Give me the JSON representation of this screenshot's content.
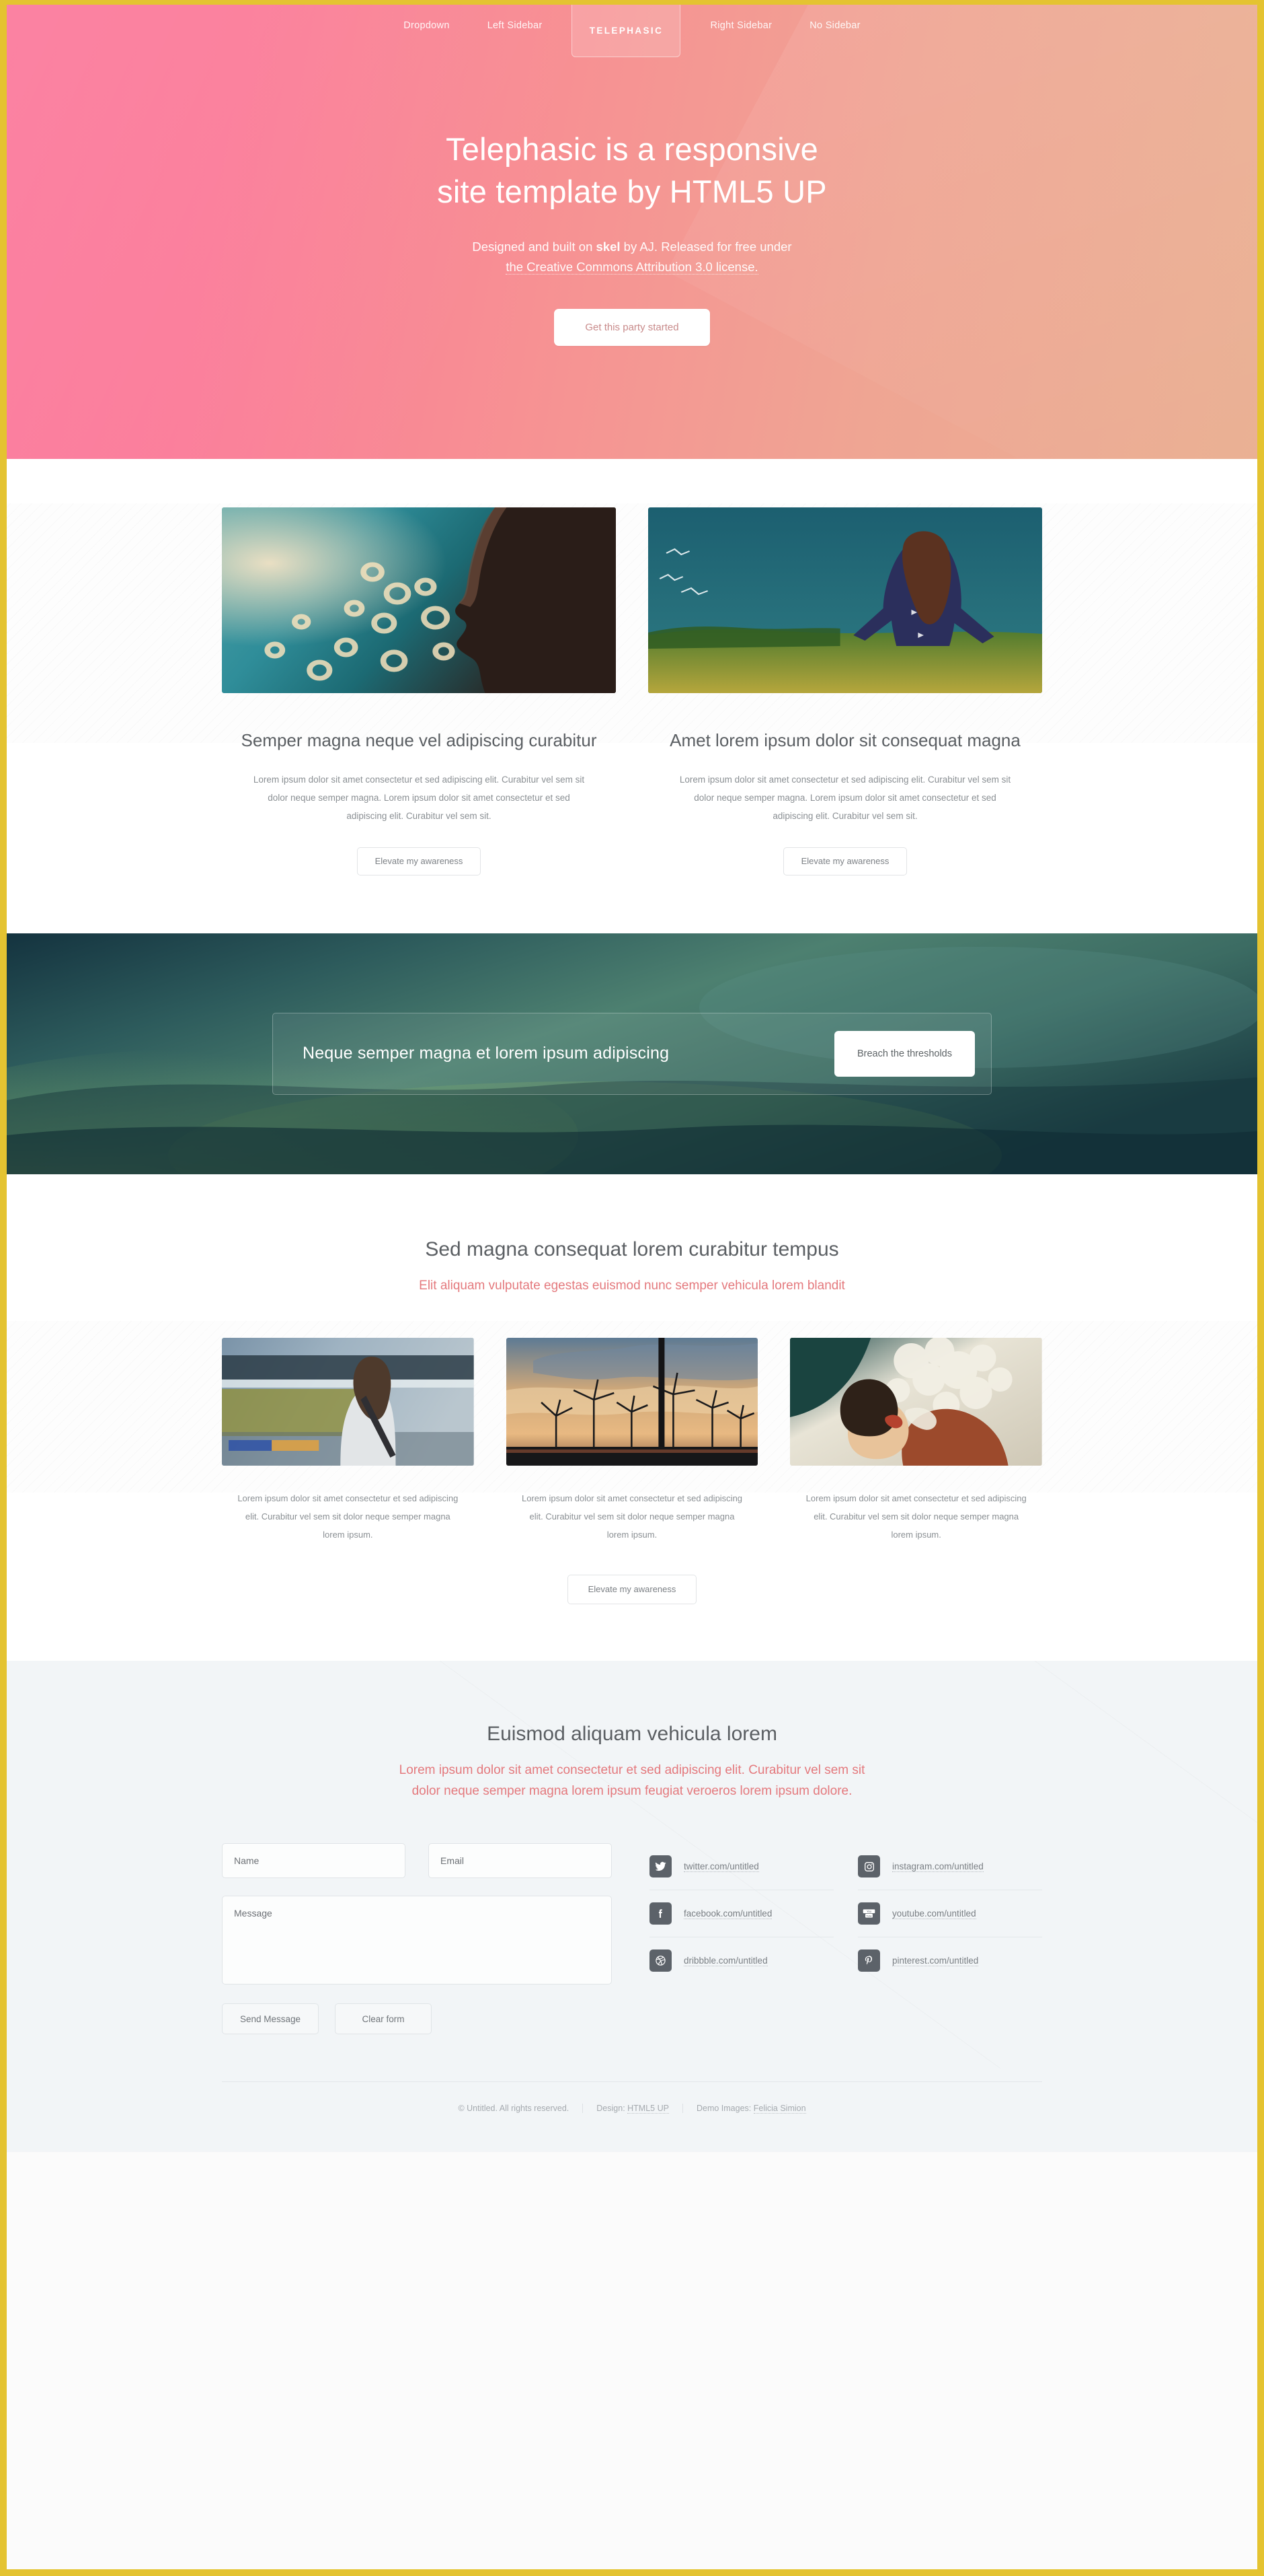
{
  "nav": {
    "logo": "TELEPHASIC",
    "left_items": [
      {
        "label": "Dropdown"
      },
      {
        "label": "Left Sidebar"
      }
    ],
    "right_items": [
      {
        "label": "Right Sidebar"
      },
      {
        "label": "No Sidebar"
      }
    ]
  },
  "hero": {
    "title_line1": "Telephasic is a responsive",
    "title_line2": "site template by HTML5 UP",
    "sub_1": "Designed and built on ",
    "sub_bold": "skel",
    "sub_2": " by AJ. Released for free under",
    "sub_3": "the Creative Commons Attribution 3.0 license.",
    "cta_label": "Get this party started"
  },
  "features": [
    {
      "image_name": "man-bokeh-photo",
      "heading": "Semper magna neque vel adipiscing curabitur",
      "body": "Lorem ipsum dolor sit amet consectetur et sed adipiscing elit. Curabitur vel sem sit dolor neque semper magna. Lorem ipsum dolor sit amet consectetur et sed adipiscing elit. Curabitur vel sem sit.",
      "button": "Elevate my awareness"
    },
    {
      "image_name": "woman-field-photo",
      "heading": "Amet lorem ipsum dolor sit consequat magna",
      "body": "Lorem ipsum dolor sit amet consectetur et sed adipiscing elit. Curabitur vel sem sit dolor neque semper magna. Lorem ipsum dolor sit amet consectetur et sed adipiscing elit. Curabitur vel sem sit.",
      "button": "Elevate my awareness"
    }
  ],
  "banner": {
    "image_name": "aurora-landscape-photo",
    "text": "Neque semper magna et lorem ipsum adipiscing",
    "button": "Breach the thresholds"
  },
  "threeup": {
    "heading": "Sed magna consequat lorem curabitur tempus",
    "subheading": "Elit aliquam vulputate egestas euismod nunc semper vehicula lorem blandit",
    "columns": [
      {
        "image_name": "train-platform-photo",
        "body": "Lorem ipsum dolor sit amet consectetur et sed adipiscing elit. Curabitur vel sem sit dolor neque semper magna lorem ipsum."
      },
      {
        "image_name": "wind-turbines-photo",
        "body": "Lorem ipsum dolor sit amet consectetur et sed adipiscing elit. Curabitur vel sem sit dolor neque semper magna lorem ipsum."
      },
      {
        "image_name": "woman-flowers-photo",
        "body": "Lorem ipsum dolor sit amet consectetur et sed adipiscing elit. Curabitur vel sem sit dolor neque semper magna lorem ipsum."
      }
    ],
    "button": "Elevate my awareness"
  },
  "contact": {
    "heading": "Euismod aliquam vehicula lorem",
    "subheading_line1": "Lorem ipsum dolor sit amet consectetur et sed adipiscing elit. Curabitur vel sem sit",
    "subheading_line2": "dolor neque semper magna lorem ipsum feugiat veroeros lorem ipsum dolore.",
    "form": {
      "name_placeholder": "Name",
      "name_value": "",
      "email_placeholder": "Email",
      "email_value": "",
      "message_placeholder": "Message",
      "message_value": "",
      "send_label": "Send Message",
      "clear_label": "Clear form"
    },
    "social": [
      {
        "icon": "twitter-icon",
        "label": "twitter.com/untitled"
      },
      {
        "icon": "instagram-icon",
        "label": "instagram.com/untitled"
      },
      {
        "icon": "facebook-icon",
        "label": "facebook.com/untitled"
      },
      {
        "icon": "youtube-icon",
        "label": "youtube.com/untitled"
      },
      {
        "icon": "dribbble-icon",
        "label": "dribbble.com/untitled"
      },
      {
        "icon": "pinterest-icon",
        "label": "pinterest.com/untitled"
      }
    ]
  },
  "copyright": {
    "items": [
      {
        "text": "© Untitled. All rights reserved."
      },
      {
        "text": "Design: ",
        "link": "HTML5 UP"
      },
      {
        "text": "Demo Images: ",
        "link": "Felicia Simion"
      }
    ]
  },
  "colors": {
    "accent_border": "#e4c331",
    "hero_pink": "#fb7498",
    "hero_peach": "#eab093",
    "sub_red": "#e4797d",
    "social_chip": "#5c6269"
  }
}
